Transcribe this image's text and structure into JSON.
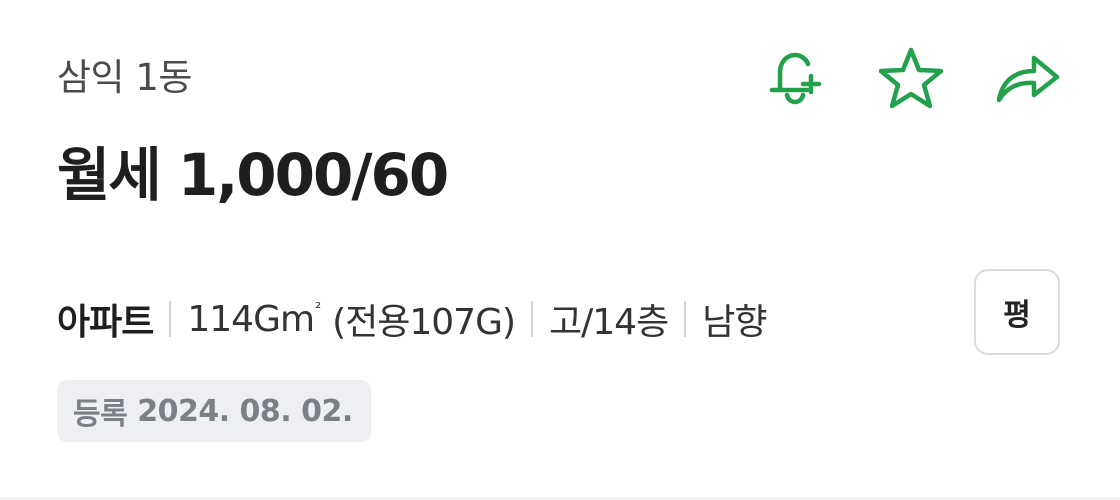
{
  "listing": {
    "complex_name": "삼익 1동",
    "price": "월세 1,000/60",
    "property_type": "아파트",
    "area": "114G",
    "area_unit": "m",
    "area_superscript": "²",
    "exclusive_area": "(전용107G)",
    "floor": "고/14층",
    "direction": "남향",
    "registered_label": "등록",
    "registered_date": "2024. 08. 02."
  },
  "actions": {
    "icons": [
      "bell-plus-icon",
      "star-icon",
      "share-icon"
    ],
    "color": "#22a04b"
  },
  "pyeong_button": {
    "label": "평"
  },
  "colors": {
    "accent": "#22a04b",
    "badge_bg": "#eeeff2",
    "badge_text": "#7b7f86",
    "title_text": "#1f1f1f"
  }
}
